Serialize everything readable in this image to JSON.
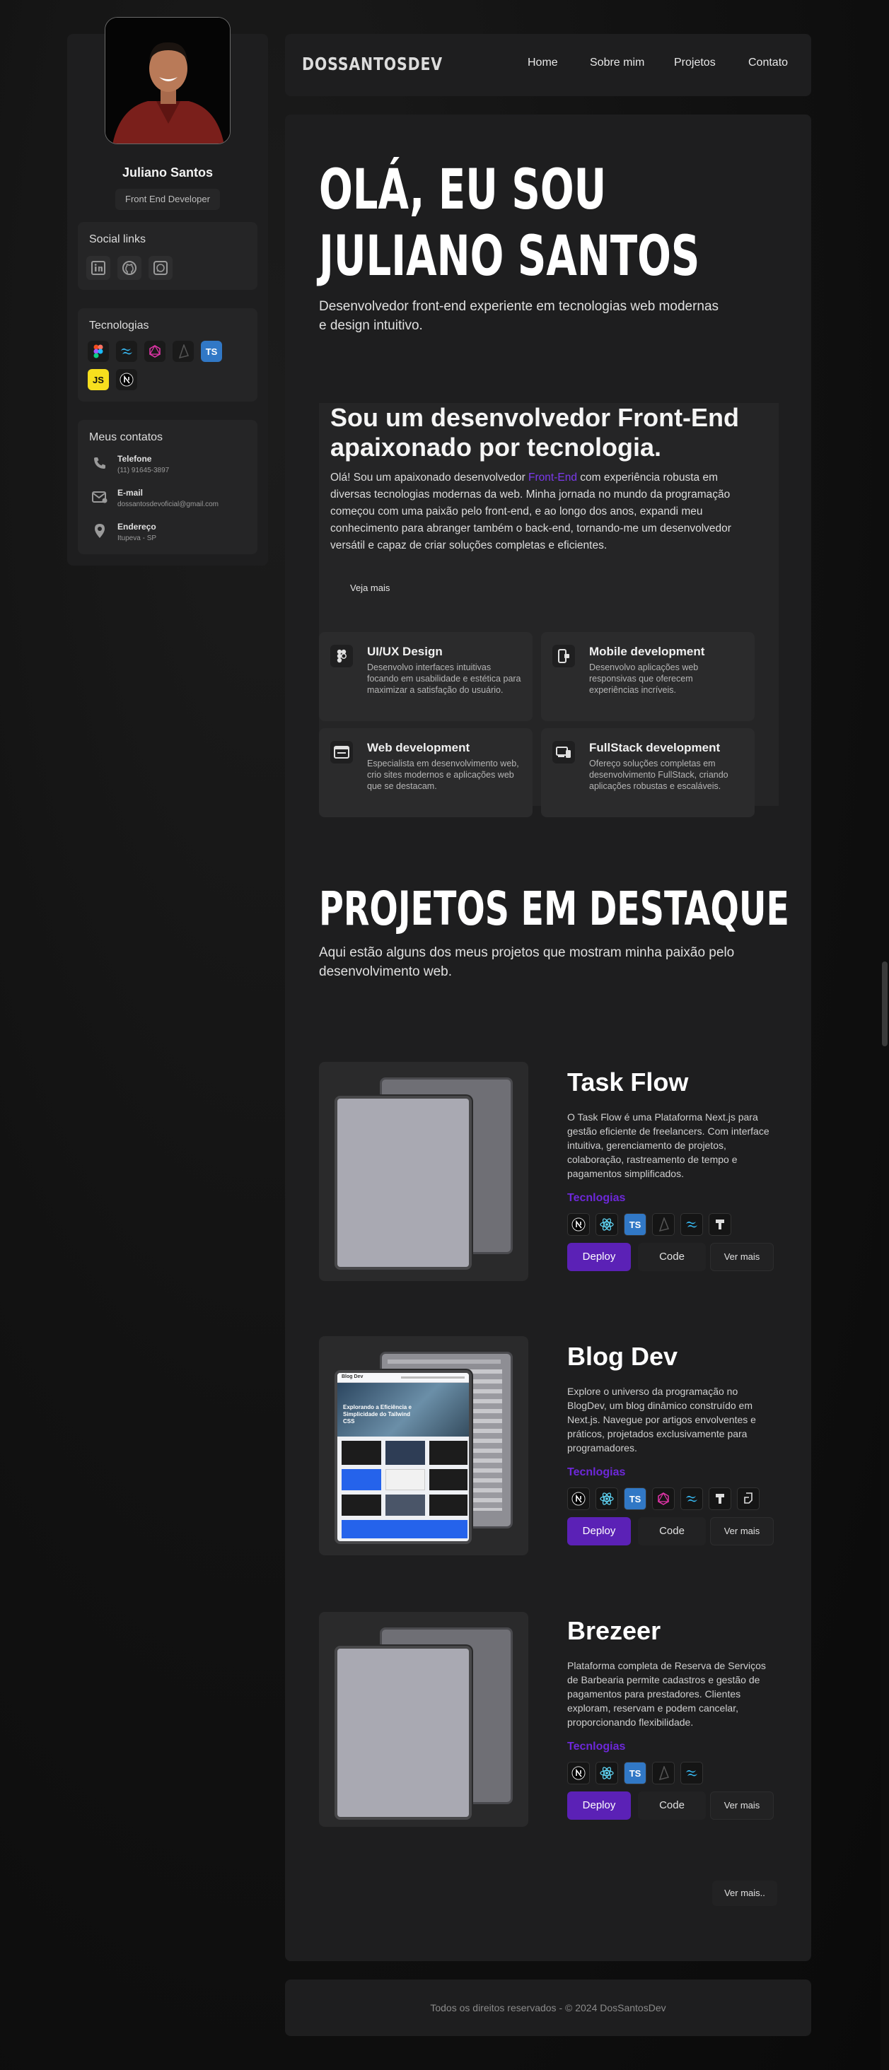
{
  "profile": {
    "name": "Juliano Santos",
    "role": "Front End Developer"
  },
  "social": {
    "title": "Social links",
    "icons": [
      "linkedin-icon",
      "github-icon",
      "whatsapp-icon"
    ]
  },
  "technologies": {
    "title": "Tecnologias",
    "icons": [
      "figma-icon",
      "tailwind-icon",
      "graphql-icon",
      "prisma-icon",
      "typescript-icon",
      "javascript-icon",
      "nextjs-icon"
    ]
  },
  "contacts": {
    "title": "Meus contatos",
    "items": [
      {
        "label": "Telefone",
        "value": "(11) 91645-3897",
        "icon": "phone-icon"
      },
      {
        "label": "E-mail",
        "value": "dossantosdevoficial@gmail.com",
        "icon": "mail-icon"
      },
      {
        "label": "Endereço",
        "value": "Itupeva - SP",
        "icon": "location-icon"
      }
    ]
  },
  "header": {
    "logo": "DOSSANTOSDEV",
    "nav": [
      "Home",
      "Sobre mim",
      "Projetos",
      "Contato"
    ]
  },
  "hero": {
    "line1": "OLÁ, EU SOU",
    "line2": "JULIANO SANTOS",
    "subtitle": "Desenvolvedor front-end experiente em tecnologias web modernas e design intuitivo."
  },
  "about": {
    "title": "Sou um desenvolvedor Front-End apaixonado por tecnologia.",
    "text_before": "Olá! Sou um apaixonado desenvolvedor ",
    "text_accent": "Front-End",
    "text_after": " com experiência robusta em diversas tecnologias modernas da web. Minha jornada no mundo da programação começou com uma paixão pelo front-end, e ao longo dos anos, expandi meu conhecimento para abranger também o back-end, tornando-me um desenvolvedor versátil e capaz de criar soluções completas e eficientes.",
    "see_more": "Veja mais",
    "services": [
      {
        "title": "UI/UX Design",
        "desc": "Desenvolvo interfaces intuitivas focando em usabilidade e estética para maximizar a satisfação do usuário.",
        "icon": "figma-icon"
      },
      {
        "title": "Mobile development",
        "desc": "Desenvolvo aplicações web responsivas que oferecem experiências incríveis.",
        "icon": "mobile-icon"
      },
      {
        "title": "Web development",
        "desc": "Especialista em desenvolvimento web, crio sites modernos e aplicações web que se destacam.",
        "icon": "browser-icon"
      },
      {
        "title": "FullStack development",
        "desc": "Ofereço soluções completas em desenvolvimento FullStack, criando aplicações robustas e escaláveis.",
        "icon": "devices-icon"
      }
    ]
  },
  "projects": {
    "heading": "PROJETOS EM DESTAQUE",
    "subtitle": "Aqui estão alguns dos meus projetos que mostram minha paixão pelo desenvolvimento web.",
    "tech_label": "Tecnlogias",
    "deploy_label": "Deploy",
    "code_label": "Code",
    "more_label": "Ver mais",
    "see_all": "Ver mais..",
    "items": [
      {
        "title": "Task Flow",
        "desc": "O Task Flow é uma Plataforma Next.js para gestão eficiente de freelancers. Com interface intuitiva, gerenciamento de projetos, colaboração, rastreamento de tempo e pagamentos simplificados.",
        "icons": [
          "nextjs-icon",
          "react-icon",
          "typescript-icon",
          "prisma-icon",
          "tailwind-icon",
          "shadcn-icon"
        ]
      },
      {
        "title": "Blog Dev",
        "desc": "Explore o universo da programação no BlogDev, um blog dinâmico construído em Next.js. Navegue por artigos envolventes e práticos, projetados exclusivamente para programadores.",
        "icons": [
          "nextjs-icon",
          "react-icon",
          "typescript-icon",
          "graphql-icon",
          "tailwind-icon",
          "shadcn-icon",
          "hygraph-icon"
        ]
      },
      {
        "title": "Brezeer",
        "desc": "Plataforma completa de Reserva de Serviços de Barbearia permite cadastros e gestão de pagamentos para prestadores. Clientes exploram, reservam e podem cancelar, proporcionando flexibilidade.",
        "icons": [
          "nextjs-icon",
          "react-icon",
          "typescript-icon",
          "prisma-icon",
          "tailwind-icon"
        ]
      }
    ],
    "blog_preview": {
      "brand": "Blog Dev",
      "headline": "Explorando a Eficiência e Simplicidade do Tailwind CSS"
    }
  },
  "footer": {
    "text": "Todos os direitos reservados - © 2024 DosSantosDev"
  },
  "colors": {
    "accent": "#6d28d9",
    "deploy": "#5b21b6",
    "panel": "#1e1e1f",
    "card": "#252526"
  }
}
